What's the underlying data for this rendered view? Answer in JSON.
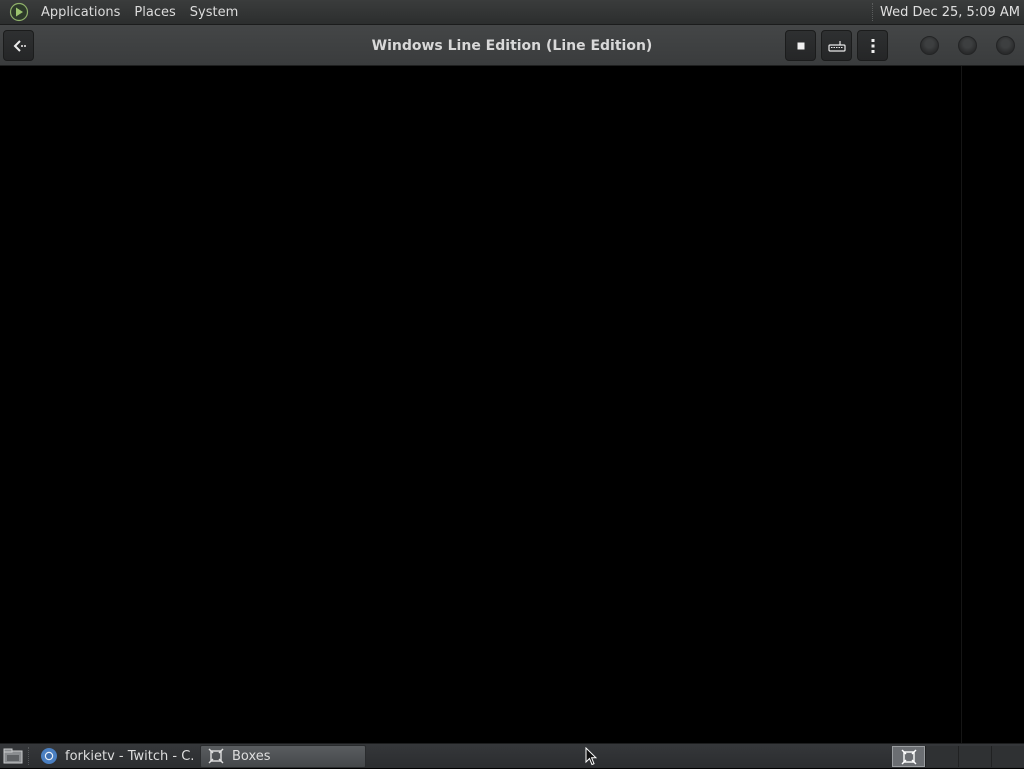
{
  "top_panel": {
    "menus": [
      "Applications",
      "Places",
      "System"
    ],
    "clock": "Wed Dec 25,  5:09 AM"
  },
  "headerbar": {
    "title": "Windows Line Edition (Line Edition)",
    "back_icon": "back-arrow-icon",
    "stop_icon": "stop-icon",
    "keyboard_icon": "keyboard-icon",
    "menu_icon": "vertical-ellipsis-icon"
  },
  "taskbar": {
    "tasks": [
      {
        "label": "forkietv - Twitch - C...",
        "icon": "chrome-icon"
      },
      {
        "label": "Boxes",
        "icon": "boxes-icon",
        "active": true
      }
    ],
    "workspaces": 4,
    "active_workspace": 1
  },
  "colors": {
    "panel": "#2c2e2e",
    "headerbar": "#3f4142",
    "vm_background": "#000000"
  }
}
